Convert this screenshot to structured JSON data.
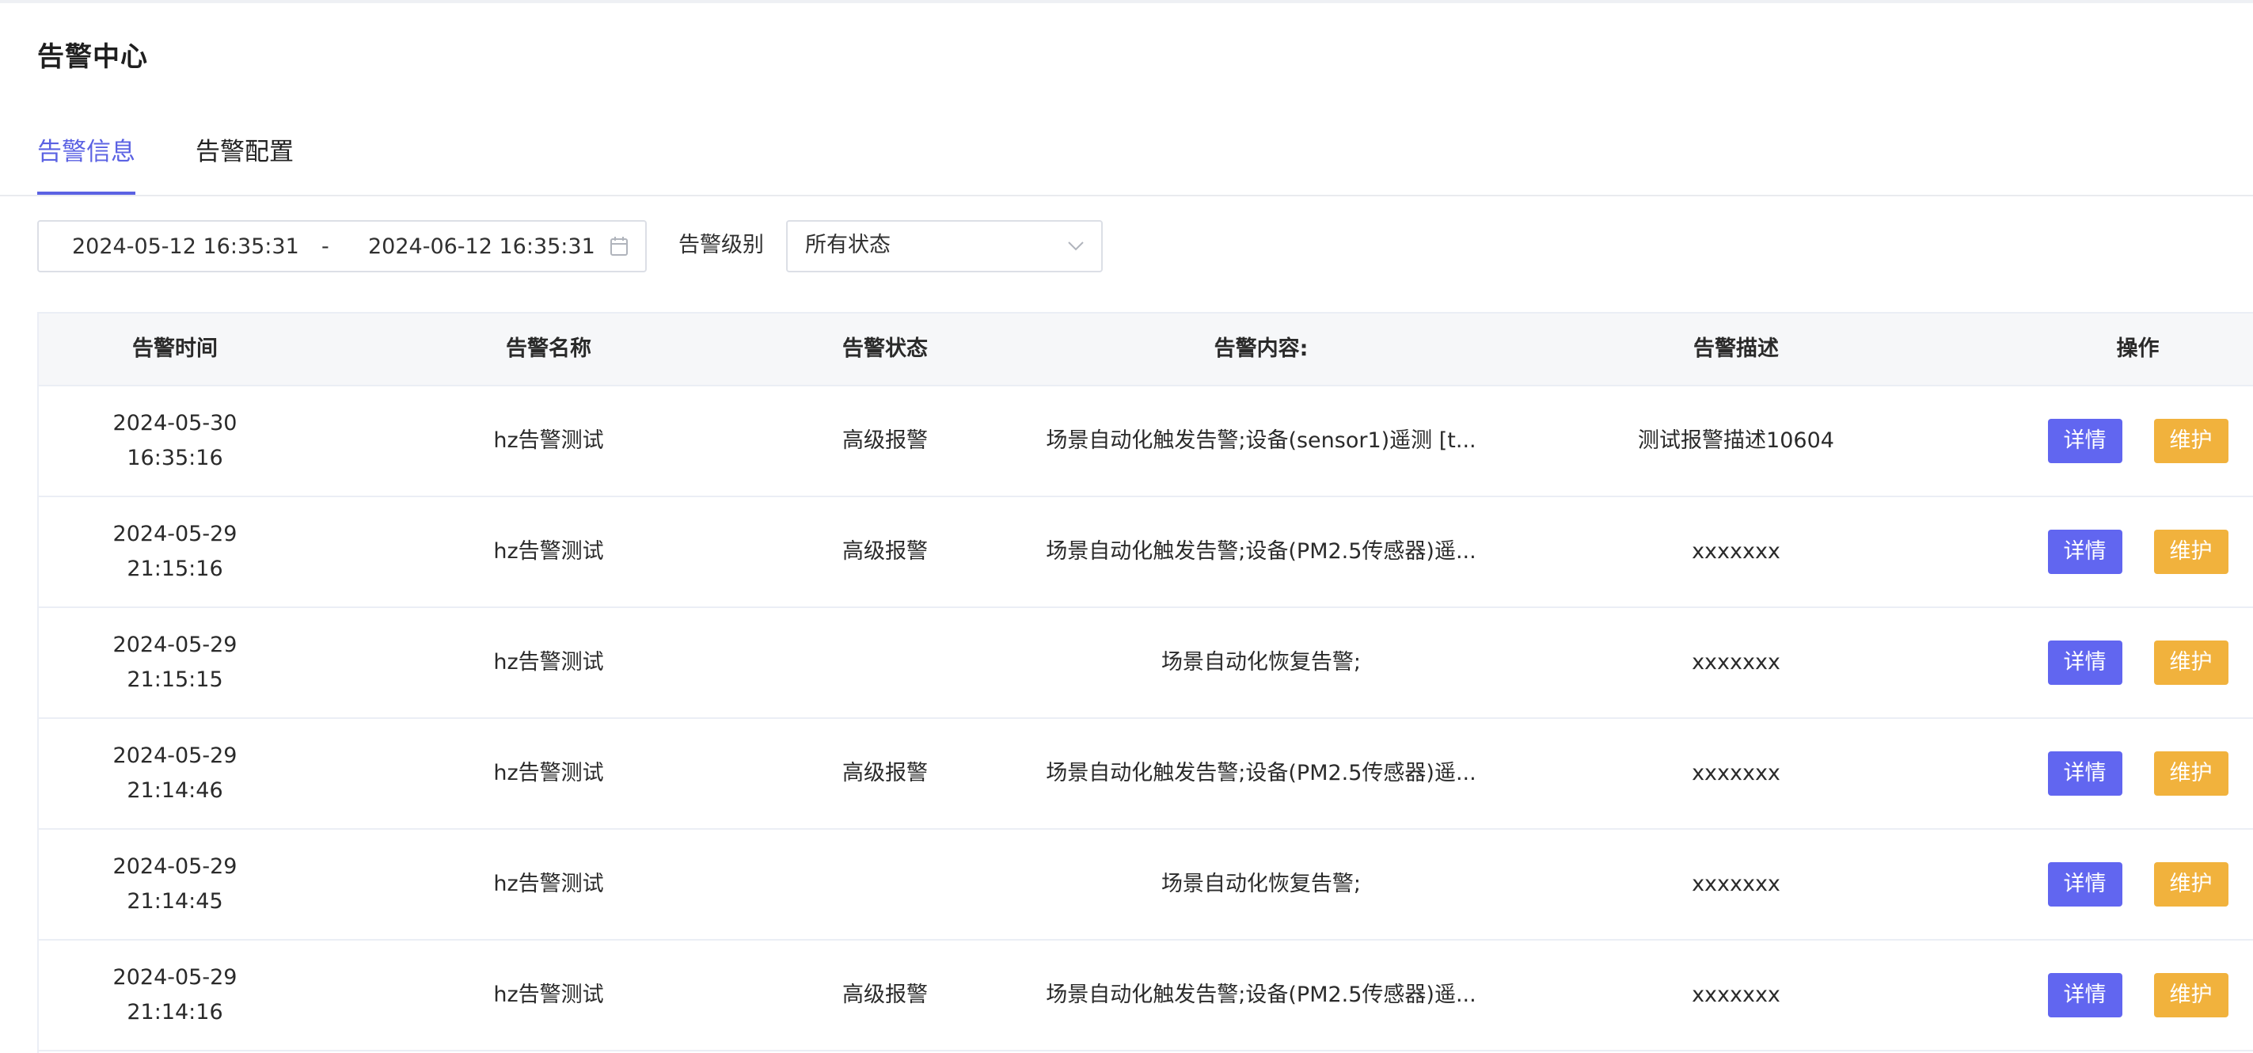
{
  "page": {
    "title": "告警中心"
  },
  "tabs": [
    {
      "label": "告警信息",
      "active": true
    },
    {
      "label": "告警配置",
      "active": false
    }
  ],
  "filters": {
    "date_start": "2024-05-12 16:35:31",
    "date_separator": "-",
    "date_end": "2024-06-12 16:35:31",
    "level_label": "告警级别",
    "level_value": "所有状态"
  },
  "table": {
    "headers": {
      "time": "告警时间",
      "name": "告警名称",
      "status": "告警状态",
      "content": "告警内容:",
      "description": "告警描述",
      "actions": "操作"
    },
    "rows": [
      {
        "time": "2024-05-30 16:35:16",
        "name": "hz告警测试",
        "status": "高级报警",
        "content": "场景自动化触发告警;设备(sensor1)遥测 [t...",
        "description": "测试报警描述10604",
        "detail_label": "详情",
        "maint_label": "维护"
      },
      {
        "time": "2024-05-29 21:15:16",
        "name": "hz告警测试",
        "status": "高级报警",
        "content": "场景自动化触发告警;设备(PM2.5传感器)遥...",
        "description": "xxxxxxx",
        "detail_label": "详情",
        "maint_label": "维护"
      },
      {
        "time": "2024-05-29 21:15:15",
        "name": "hz告警测试",
        "status": "",
        "content": "场景自动化恢复告警;",
        "description": "xxxxxxx",
        "detail_label": "详情",
        "maint_label": "维护"
      },
      {
        "time": "2024-05-29 21:14:46",
        "name": "hz告警测试",
        "status": "高级报警",
        "content": "场景自动化触发告警;设备(PM2.5传感器)遥...",
        "description": "xxxxxxx",
        "detail_label": "详情",
        "maint_label": "维护"
      },
      {
        "time": "2024-05-29 21:14:45",
        "name": "hz告警测试",
        "status": "",
        "content": "场景自动化恢复告警;",
        "description": "xxxxxxx",
        "detail_label": "详情",
        "maint_label": "维护"
      },
      {
        "time": "2024-05-29 21:14:16",
        "name": "hz告警测试",
        "status": "高级报警",
        "content": "场景自动化触发告警;设备(PM2.5传感器)遥...",
        "description": "xxxxxxx",
        "detail_label": "详情",
        "maint_label": "维护"
      }
    ]
  },
  "icons": {
    "calendar": "calendar-icon",
    "dropdown": "chevron-down-icon"
  },
  "colors": {
    "accent": "#5b62e3",
    "detail_button": "#6166f0",
    "maintain_button": "#f1b23d",
    "header_bg": "#f6f7f9",
    "border": "#ebeef5"
  }
}
